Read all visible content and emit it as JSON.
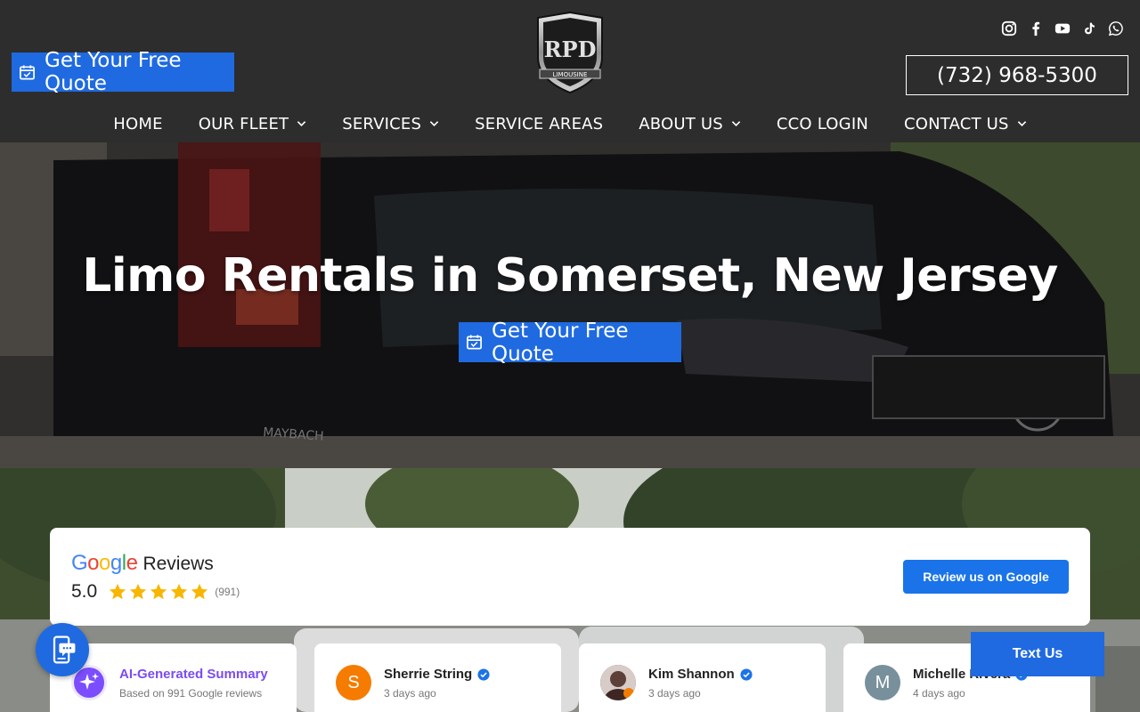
{
  "header": {
    "quote_button": "Get Your Free Quote",
    "phone": "(732) 968-5300",
    "logo_text": "RPD",
    "logo_subtext": "LIMOUSINE",
    "social_icons": [
      "instagram-icon",
      "facebook-icon",
      "youtube-icon",
      "tiktok-icon",
      "whatsapp-icon"
    ]
  },
  "nav": {
    "items": [
      {
        "label": "HOME",
        "has_dropdown": false
      },
      {
        "label": "OUR FLEET",
        "has_dropdown": true
      },
      {
        "label": "SERVICES",
        "has_dropdown": true
      },
      {
        "label": "SERVICE AREAS",
        "has_dropdown": false
      },
      {
        "label": "ABOUT US",
        "has_dropdown": true
      },
      {
        "label": "CCO LOGIN",
        "has_dropdown": false
      },
      {
        "label": "CONTACT US",
        "has_dropdown": true
      }
    ]
  },
  "hero": {
    "title": "Limo Rentals in Somerset, New Jersey",
    "quote_button": "Get Your Free Quote"
  },
  "reviews": {
    "brand": "Google",
    "heading": "Reviews",
    "rating": "5.0",
    "stars": 5,
    "count": "(991)",
    "review_button": "Review us on Google",
    "cards": [
      {
        "name": "AI-Generated Summary",
        "sub": "Based on 991 Google reviews",
        "avatar": "",
        "avatar_color": "#8b5cf6",
        "verified": false
      },
      {
        "name": "Sherrie String",
        "sub": "3 days ago",
        "avatar": "S",
        "avatar_color": "#f57c00",
        "verified": true
      },
      {
        "name": "Kim Shannon",
        "sub": "3 days ago",
        "avatar": "",
        "avatar_color": "#5d4037",
        "verified": true
      },
      {
        "name": "Michelle Rivera",
        "sub": "4 days ago",
        "avatar": "M",
        "avatar_color": "#78909c",
        "verified": true
      }
    ]
  },
  "floating": {
    "text_us": "Text Us"
  },
  "colors": {
    "brand_blue": "#1f6ae0",
    "header_bg": "#2d2d2d",
    "google_blue": "#1a73e8",
    "star": "#f8b600"
  }
}
